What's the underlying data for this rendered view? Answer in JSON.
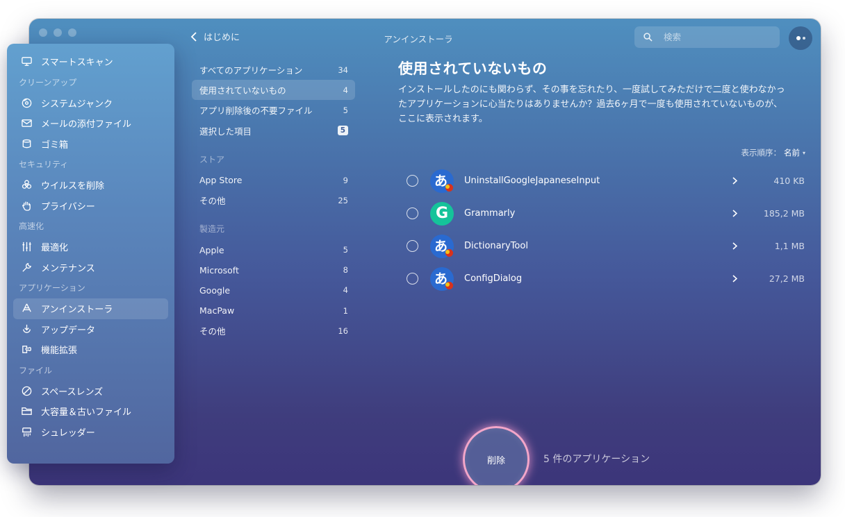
{
  "window": {
    "title": "アンインストーラ",
    "back_label": "はじめに"
  },
  "search": {
    "placeholder": "検索"
  },
  "sidebar": {
    "top_item": {
      "label": "スマートスキャン",
      "icon": "monitor-icon"
    },
    "sections": [
      {
        "title": "クリーンアップ",
        "items": [
          {
            "label": "システムジャンク",
            "icon": "disc-icon"
          },
          {
            "label": "メールの添付ファイル",
            "icon": "envelope-icon"
          },
          {
            "label": "ゴミ箱",
            "icon": "trash-icon"
          }
        ]
      },
      {
        "title": "セキュリティ",
        "items": [
          {
            "label": "ウイルスを削除",
            "icon": "biohazard-icon"
          },
          {
            "label": "プライバシー",
            "icon": "hand-icon"
          }
        ]
      },
      {
        "title": "高速化",
        "items": [
          {
            "label": "最適化",
            "icon": "sliders-icon"
          },
          {
            "label": "メンテナンス",
            "icon": "wrench-icon"
          }
        ]
      },
      {
        "title": "アプリケーション",
        "items": [
          {
            "label": "アンインストーラ",
            "icon": "uninstaller-icon",
            "active": true
          },
          {
            "label": "アップデータ",
            "icon": "updater-icon"
          },
          {
            "label": "機能拡張",
            "icon": "extensions-icon"
          }
        ]
      },
      {
        "title": "ファイル",
        "items": [
          {
            "label": "スペースレンズ",
            "icon": "lens-icon"
          },
          {
            "label": "大容量＆古いファイル",
            "icon": "folder-icon"
          },
          {
            "label": "シュレッダー",
            "icon": "shredder-icon"
          }
        ]
      }
    ]
  },
  "categories": {
    "main": [
      {
        "label": "すべてのアプリケーション",
        "count": "34"
      },
      {
        "label": "使用されていないもの",
        "count": "4",
        "active": true
      },
      {
        "label": "アプリ削除後の不要ファイル",
        "count": "5"
      },
      {
        "label": "選択した項目",
        "count": "5",
        "badge": true
      }
    ],
    "store": {
      "title": "ストア",
      "items": [
        {
          "label": "App Store",
          "count": "9"
        },
        {
          "label": "その他",
          "count": "25"
        }
      ]
    },
    "vendor": {
      "title": "製造元",
      "items": [
        {
          "label": "Apple",
          "count": "5"
        },
        {
          "label": "Microsoft",
          "count": "8"
        },
        {
          "label": "Google",
          "count": "4"
        },
        {
          "label": "MacPaw",
          "count": "1"
        },
        {
          "label": "その他",
          "count": "16"
        }
      ]
    }
  },
  "main": {
    "title": "使用されていないもの",
    "description": "インストールしたのにも関わらず、その事を忘れたり、一度試してみただけで二度と使わなかったアプリケーションに心当たりはありませんか？過去6ヶ月で一度も使用されていないものが、ここに表示されます。",
    "sort_label": "表示順序：",
    "sort_value": "名前",
    "apps": [
      {
        "name": "UninstallGoogleJapaneseInput",
        "size": "410 KB",
        "icon": "google-ime-icon",
        "glyph": "あ"
      },
      {
        "name": "Grammarly",
        "size": "185,2 MB",
        "icon": "grammarly-icon",
        "glyph": "G"
      },
      {
        "name": "DictionaryTool",
        "size": "1,1 MB",
        "icon": "google-ime-icon",
        "glyph": "あ"
      },
      {
        "name": "ConfigDialog",
        "size": "27,2 MB",
        "icon": "google-ime-icon",
        "glyph": "あ"
      }
    ]
  },
  "footer": {
    "remove_label": "削除",
    "summary": "5 件のアプリケーション"
  },
  "colors": {
    "accent_ring": "#f3a6c9",
    "grammarly": "#15c39a",
    "ime_blue": "#2a6ad0"
  }
}
